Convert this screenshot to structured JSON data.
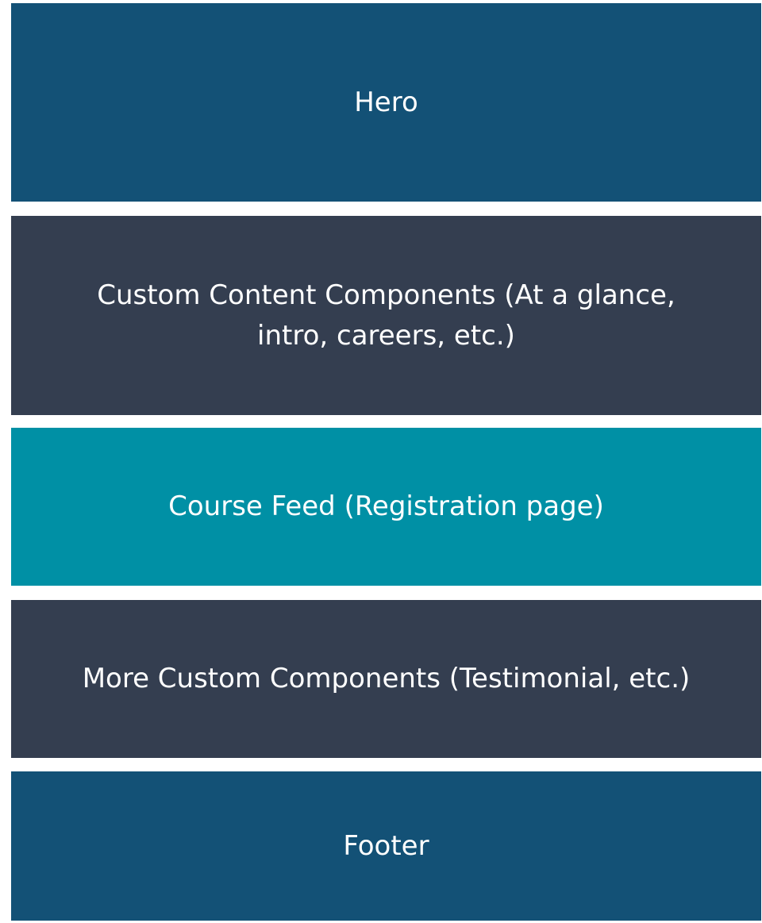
{
  "blocks": [
    {
      "id": "hero",
      "label": "Hero",
      "color": "#135176"
    },
    {
      "id": "custom",
      "label_lines": [
        "Custom Content Components (At a glance,",
        "intro, careers, etc.)"
      ],
      "color": "#343e50"
    },
    {
      "id": "course",
      "label": "Course Feed (Registration page)",
      "color": "#0090a5"
    },
    {
      "id": "more",
      "label": "More Custom Components (Testimonial, etc.)",
      "color": "#343e50"
    },
    {
      "id": "footer",
      "label": "Footer",
      "color": "#135176"
    }
  ]
}
